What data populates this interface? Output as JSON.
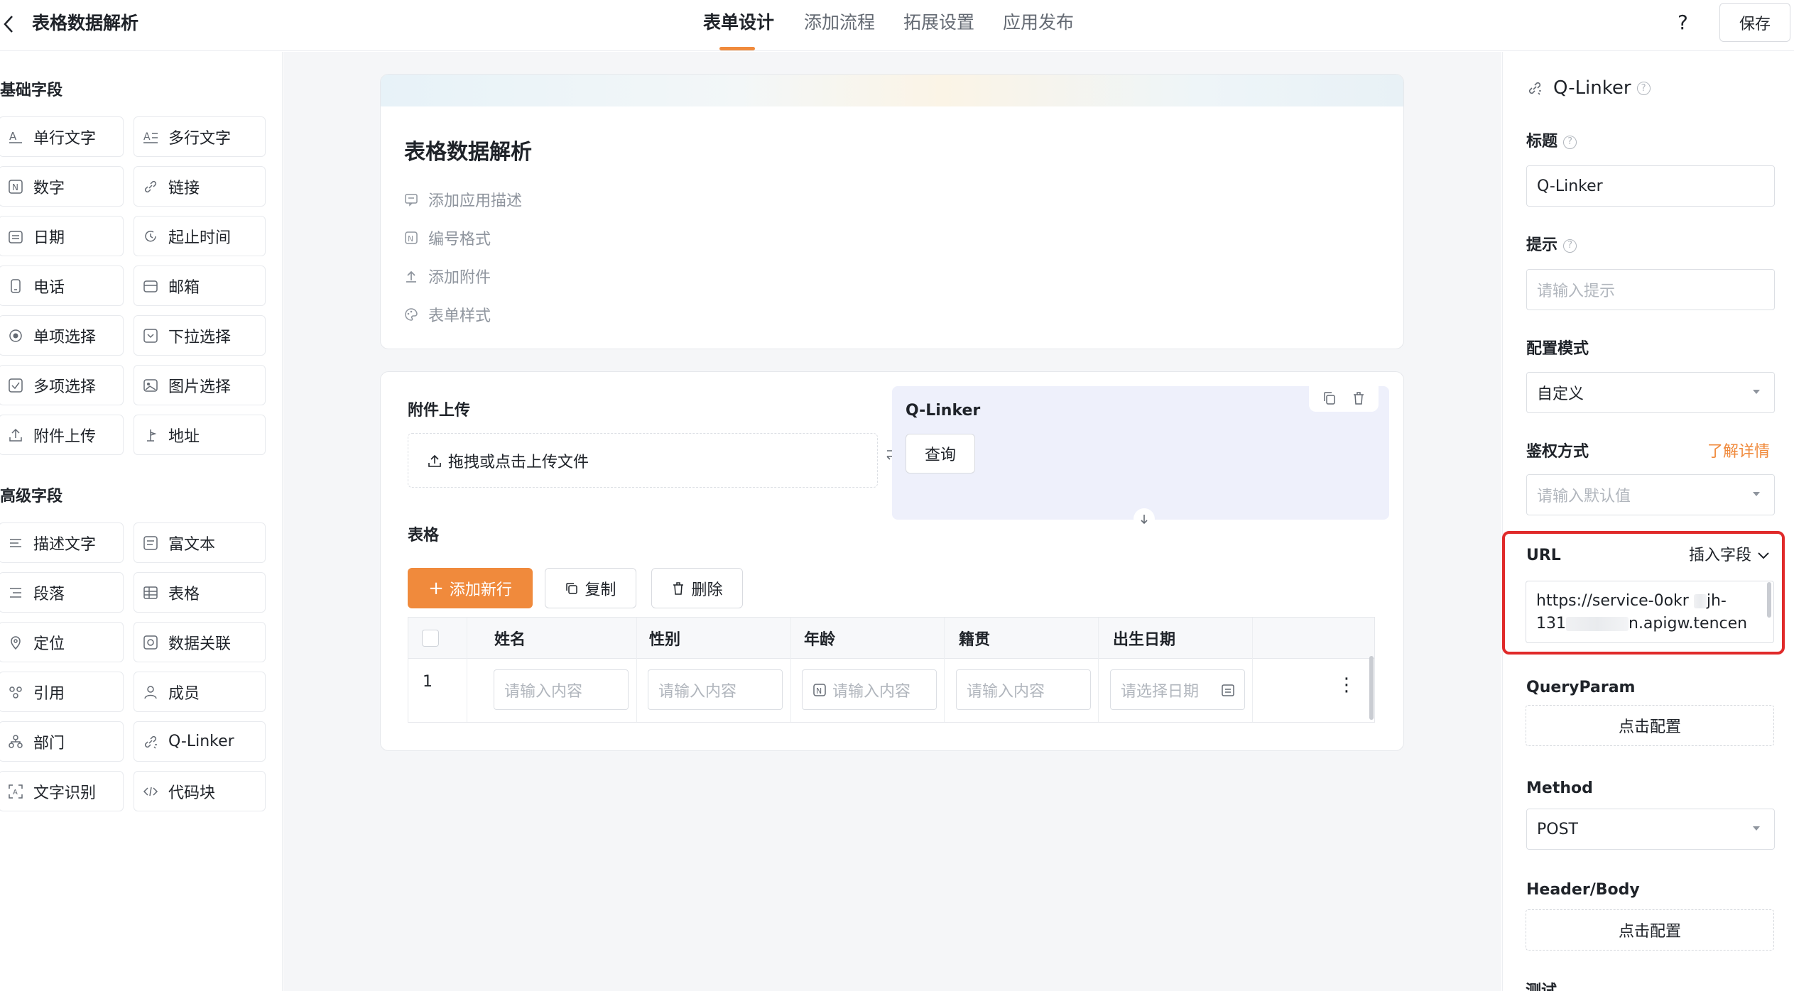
{
  "header": {
    "back_icon": "chevron-left-icon",
    "title": "表格数据解析",
    "tabs": [
      {
        "label": "表单设计",
        "active": true
      },
      {
        "label": "添加流程",
        "active": false
      },
      {
        "label": "拓展设置",
        "active": false
      },
      {
        "label": "应用发布",
        "active": false
      }
    ],
    "help": "?",
    "save": "保存",
    "accent_color": "#f08a3c"
  },
  "palette": {
    "basic_title": "基础字段",
    "basic": [
      {
        "label": "单行文字",
        "icon": "single-line-text-icon"
      },
      {
        "label": "多行文字",
        "icon": "multi-line-text-icon"
      },
      {
        "label": "数字",
        "icon": "number-icon"
      },
      {
        "label": "链接",
        "icon": "link-icon"
      },
      {
        "label": "日期",
        "icon": "date-icon"
      },
      {
        "label": "起止时间",
        "icon": "time-range-icon"
      },
      {
        "label": "电话",
        "icon": "phone-icon"
      },
      {
        "label": "邮箱",
        "icon": "mail-icon"
      },
      {
        "label": "单项选择",
        "icon": "radio-icon"
      },
      {
        "label": "下拉选择",
        "icon": "dropdown-icon"
      },
      {
        "label": "多项选择",
        "icon": "checkbox-icon"
      },
      {
        "label": "图片选择",
        "icon": "image-icon"
      },
      {
        "label": "附件上传",
        "icon": "upload-icon"
      },
      {
        "label": "地址",
        "icon": "location-pin-icon"
      }
    ],
    "advanced_title": "高级字段",
    "advanced": [
      {
        "label": "描述文字",
        "icon": "description-icon"
      },
      {
        "label": "富文本",
        "icon": "rich-text-icon"
      },
      {
        "label": "段落",
        "icon": "paragraph-icon"
      },
      {
        "label": "表格",
        "icon": "table-icon"
      },
      {
        "label": "定位",
        "icon": "position-icon"
      },
      {
        "label": "数据关联",
        "icon": "data-link-icon"
      },
      {
        "label": "引用",
        "icon": "reference-icon"
      },
      {
        "label": "成员",
        "icon": "member-icon"
      },
      {
        "label": "部门",
        "icon": "department-icon"
      },
      {
        "label": "Q-Linker",
        "icon": "q-linker-icon"
      },
      {
        "label": "文字识别",
        "icon": "ocr-icon"
      },
      {
        "label": "代码块",
        "icon": "code-icon"
      }
    ]
  },
  "form": {
    "title": "表格数据解析",
    "options": [
      {
        "label": "添加应用描述",
        "icon": "comment-icon"
      },
      {
        "label": "编号格式",
        "icon": "number-format-icon"
      },
      {
        "label": "添加附件",
        "icon": "attach-icon"
      },
      {
        "label": "表单样式",
        "icon": "palette-icon"
      }
    ],
    "attachment_label": "附件上传",
    "upload_text": "拖拽或点击上传文件",
    "qlinker_label": "Q-Linker",
    "query_button": "查询",
    "table_label": "表格",
    "add_row": "添加新行",
    "copy": "复制",
    "delete": "删除",
    "columns": [
      "姓名",
      "性别",
      "年龄",
      "籍贯",
      "出生日期"
    ],
    "row_number": "1",
    "cell_placeholder": "请输入内容",
    "date_placeholder": "请选择日期",
    "row_menu": "⋮"
  },
  "props": {
    "title": "Q-Linker",
    "label_title": "标题",
    "title_value": "Q-Linker",
    "label_hint": "提示",
    "hint_placeholder": "请输入提示",
    "label_mode": "配置模式",
    "mode_value": "自定义",
    "label_auth": "鉴权方式",
    "learn_more": "了解详情",
    "auth_placeholder": "请输入默认值",
    "label_url": "URL",
    "insert_field": "插入字段",
    "url_line1": "https://service-0okr",
    "url_line1_tail": "jh-",
    "url_line2_head": "131",
    "url_line2_tail": "n.apigw.tencen",
    "label_query": "QueryParam",
    "query_btn": "点击配置",
    "label_method": "Method",
    "method_value": "POST",
    "label_header": "Header/Body",
    "header_btn": "点击配置",
    "label_test": "测试",
    "highlight_color": "#e02a2a"
  }
}
